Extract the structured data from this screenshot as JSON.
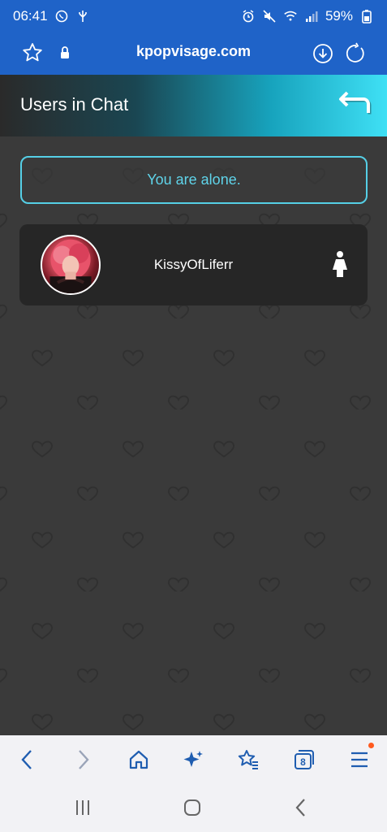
{
  "status_bar": {
    "time": "06:41",
    "battery": "59%"
  },
  "browser": {
    "url": "kpopvisage.com",
    "tab_count": "8"
  },
  "header": {
    "title": "Users in Chat"
  },
  "chat": {
    "alone_message": "You are alone.",
    "users": [
      {
        "username": "KissyOfLiferr",
        "gender_icon": "female-icon"
      }
    ]
  },
  "colors": {
    "brand_blue": "#1f63c8",
    "accent_cyan": "#55cfe6",
    "background": "#3a3a3a",
    "card": "#262626",
    "notification_dot": "#ff5a1f"
  }
}
